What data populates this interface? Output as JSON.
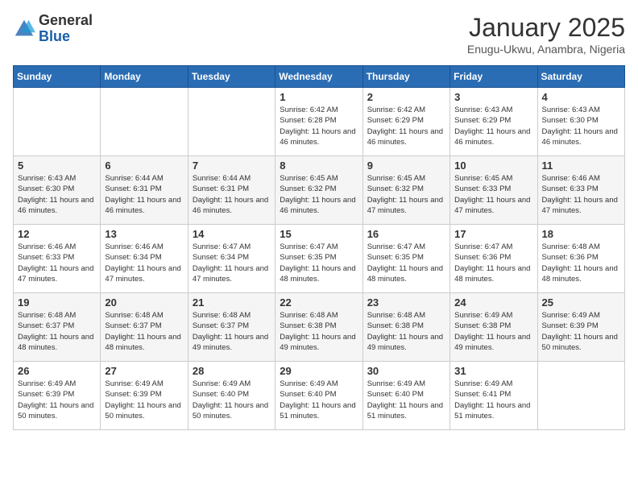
{
  "header": {
    "logo_general": "General",
    "logo_blue": "Blue",
    "month_title": "January 2025",
    "subtitle": "Enugu-Ukwu, Anambra, Nigeria"
  },
  "weekdays": [
    "Sunday",
    "Monday",
    "Tuesday",
    "Wednesday",
    "Thursday",
    "Friday",
    "Saturday"
  ],
  "weeks": [
    [
      {
        "day": "",
        "info": ""
      },
      {
        "day": "",
        "info": ""
      },
      {
        "day": "",
        "info": ""
      },
      {
        "day": "1",
        "info": "Sunrise: 6:42 AM\nSunset: 6:28 PM\nDaylight: 11 hours and 46 minutes."
      },
      {
        "day": "2",
        "info": "Sunrise: 6:42 AM\nSunset: 6:29 PM\nDaylight: 11 hours and 46 minutes."
      },
      {
        "day": "3",
        "info": "Sunrise: 6:43 AM\nSunset: 6:29 PM\nDaylight: 11 hours and 46 minutes."
      },
      {
        "day": "4",
        "info": "Sunrise: 6:43 AM\nSunset: 6:30 PM\nDaylight: 11 hours and 46 minutes."
      }
    ],
    [
      {
        "day": "5",
        "info": "Sunrise: 6:43 AM\nSunset: 6:30 PM\nDaylight: 11 hours and 46 minutes."
      },
      {
        "day": "6",
        "info": "Sunrise: 6:44 AM\nSunset: 6:31 PM\nDaylight: 11 hours and 46 minutes."
      },
      {
        "day": "7",
        "info": "Sunrise: 6:44 AM\nSunset: 6:31 PM\nDaylight: 11 hours and 46 minutes."
      },
      {
        "day": "8",
        "info": "Sunrise: 6:45 AM\nSunset: 6:32 PM\nDaylight: 11 hours and 46 minutes."
      },
      {
        "day": "9",
        "info": "Sunrise: 6:45 AM\nSunset: 6:32 PM\nDaylight: 11 hours and 47 minutes."
      },
      {
        "day": "10",
        "info": "Sunrise: 6:45 AM\nSunset: 6:33 PM\nDaylight: 11 hours and 47 minutes."
      },
      {
        "day": "11",
        "info": "Sunrise: 6:46 AM\nSunset: 6:33 PM\nDaylight: 11 hours and 47 minutes."
      }
    ],
    [
      {
        "day": "12",
        "info": "Sunrise: 6:46 AM\nSunset: 6:33 PM\nDaylight: 11 hours and 47 minutes."
      },
      {
        "day": "13",
        "info": "Sunrise: 6:46 AM\nSunset: 6:34 PM\nDaylight: 11 hours and 47 minutes."
      },
      {
        "day": "14",
        "info": "Sunrise: 6:47 AM\nSunset: 6:34 PM\nDaylight: 11 hours and 47 minutes."
      },
      {
        "day": "15",
        "info": "Sunrise: 6:47 AM\nSunset: 6:35 PM\nDaylight: 11 hours and 48 minutes."
      },
      {
        "day": "16",
        "info": "Sunrise: 6:47 AM\nSunset: 6:35 PM\nDaylight: 11 hours and 48 minutes."
      },
      {
        "day": "17",
        "info": "Sunrise: 6:47 AM\nSunset: 6:36 PM\nDaylight: 11 hours and 48 minutes."
      },
      {
        "day": "18",
        "info": "Sunrise: 6:48 AM\nSunset: 6:36 PM\nDaylight: 11 hours and 48 minutes."
      }
    ],
    [
      {
        "day": "19",
        "info": "Sunrise: 6:48 AM\nSunset: 6:37 PM\nDaylight: 11 hours and 48 minutes."
      },
      {
        "day": "20",
        "info": "Sunrise: 6:48 AM\nSunset: 6:37 PM\nDaylight: 11 hours and 48 minutes."
      },
      {
        "day": "21",
        "info": "Sunrise: 6:48 AM\nSunset: 6:37 PM\nDaylight: 11 hours and 49 minutes."
      },
      {
        "day": "22",
        "info": "Sunrise: 6:48 AM\nSunset: 6:38 PM\nDaylight: 11 hours and 49 minutes."
      },
      {
        "day": "23",
        "info": "Sunrise: 6:48 AM\nSunset: 6:38 PM\nDaylight: 11 hours and 49 minutes."
      },
      {
        "day": "24",
        "info": "Sunrise: 6:49 AM\nSunset: 6:38 PM\nDaylight: 11 hours and 49 minutes."
      },
      {
        "day": "25",
        "info": "Sunrise: 6:49 AM\nSunset: 6:39 PM\nDaylight: 11 hours and 50 minutes."
      }
    ],
    [
      {
        "day": "26",
        "info": "Sunrise: 6:49 AM\nSunset: 6:39 PM\nDaylight: 11 hours and 50 minutes."
      },
      {
        "day": "27",
        "info": "Sunrise: 6:49 AM\nSunset: 6:39 PM\nDaylight: 11 hours and 50 minutes."
      },
      {
        "day": "28",
        "info": "Sunrise: 6:49 AM\nSunset: 6:40 PM\nDaylight: 11 hours and 50 minutes."
      },
      {
        "day": "29",
        "info": "Sunrise: 6:49 AM\nSunset: 6:40 PM\nDaylight: 11 hours and 51 minutes."
      },
      {
        "day": "30",
        "info": "Sunrise: 6:49 AM\nSunset: 6:40 PM\nDaylight: 11 hours and 51 minutes."
      },
      {
        "day": "31",
        "info": "Sunrise: 6:49 AM\nSunset: 6:41 PM\nDaylight: 11 hours and 51 minutes."
      },
      {
        "day": "",
        "info": ""
      }
    ]
  ]
}
